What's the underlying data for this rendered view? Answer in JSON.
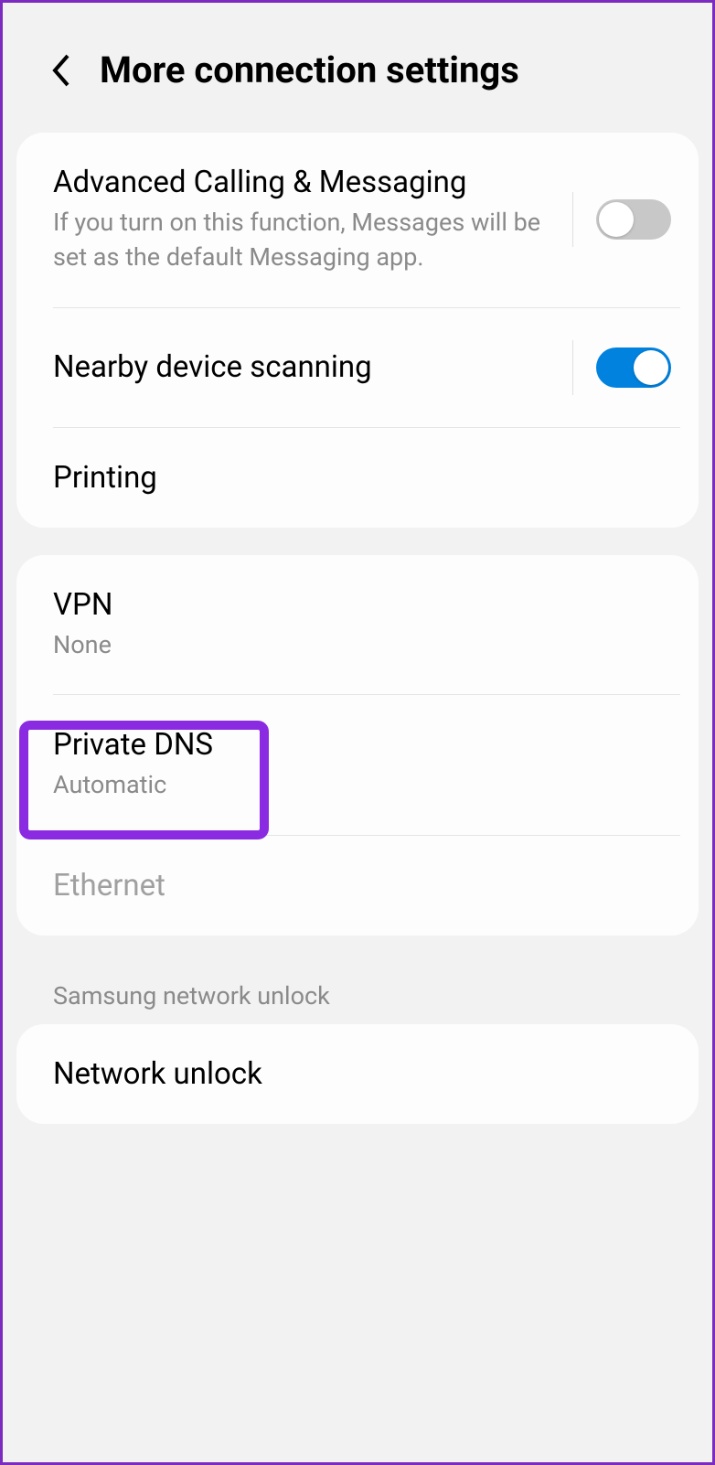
{
  "header": {
    "title": "More connection settings"
  },
  "group1": {
    "advancedCalling": {
      "title": "Advanced Calling & Messaging",
      "subtitle": "If you turn on this function, Messages will be set as the default Messaging app.",
      "enabled": false
    },
    "nearbyScanning": {
      "title": "Nearby device scanning",
      "enabled": true
    },
    "printing": {
      "title": "Printing"
    }
  },
  "group2": {
    "vpn": {
      "title": "VPN",
      "subtitle": "None"
    },
    "privateDns": {
      "title": "Private DNS",
      "subtitle": "Automatic"
    },
    "ethernet": {
      "title": "Ethernet"
    }
  },
  "sectionHeader": "Samsung network unlock",
  "group3": {
    "networkUnlock": {
      "title": "Network unlock"
    }
  }
}
